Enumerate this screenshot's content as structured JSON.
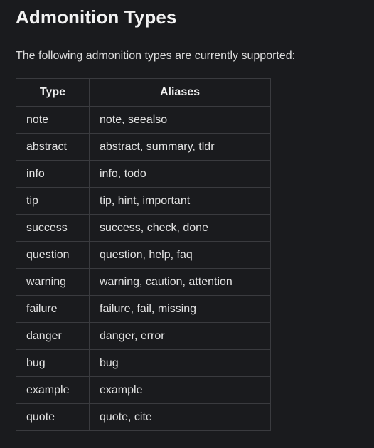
{
  "title": "Admonition Types",
  "intro": "The following admonition types are currently supported:",
  "table": {
    "headers": [
      "Type",
      "Aliases"
    ],
    "rows": [
      {
        "type": "note",
        "aliases": "note, seealso"
      },
      {
        "type": "abstract",
        "aliases": "abstract, summary, tldr"
      },
      {
        "type": "info",
        "aliases": "info, todo"
      },
      {
        "type": "tip",
        "aliases": "tip, hint, important"
      },
      {
        "type": "success",
        "aliases": "success, check, done"
      },
      {
        "type": "question",
        "aliases": "question, help, faq"
      },
      {
        "type": "warning",
        "aliases": "warning, caution, attention"
      },
      {
        "type": "failure",
        "aliases": "failure, fail, missing"
      },
      {
        "type": "danger",
        "aliases": "danger, error"
      },
      {
        "type": "bug",
        "aliases": "bug"
      },
      {
        "type": "example",
        "aliases": "example"
      },
      {
        "type": "quote",
        "aliases": "quote, cite"
      }
    ]
  }
}
